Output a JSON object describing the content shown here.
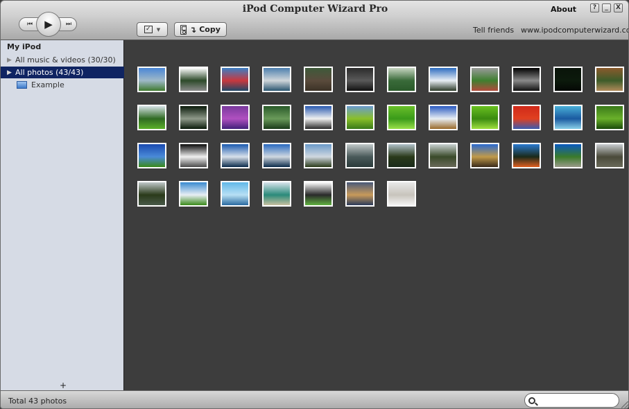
{
  "window": {
    "title": "iPod Computer Wizard Pro",
    "about_label": "About",
    "help_icon": "?",
    "minimize_icon": "_",
    "close_icon": "X"
  },
  "transport": {
    "prev_icon": "⏮",
    "play_icon": "▶",
    "next_icon": "⏭"
  },
  "toolbar": {
    "check_icon": "✓",
    "dropdown_icon": "▼",
    "copy_arrow_icon": "↴",
    "copy_label": "Copy"
  },
  "links": {
    "tell_friends": "Tell friends",
    "website": "www.ipodcomputerwizard.com"
  },
  "sidebar": {
    "title": "My iPod",
    "items": [
      {
        "label": "All music & videos (30/30)",
        "icon": "▶",
        "selected": false
      },
      {
        "label": "All photos (43/43)",
        "icon": "▶",
        "selected": true
      },
      {
        "label": "Example",
        "icon": "album-icon",
        "selected": false
      }
    ],
    "add_icon": "+"
  },
  "photos": {
    "columns": 12,
    "count": 43,
    "items": [
      {
        "name": "city-skyline",
        "colors": [
          "#4a86d6",
          "#9fb9c8",
          "#3f7a2e"
        ]
      },
      {
        "name": "pavilion",
        "colors": [
          "#ffffff",
          "#2d4a2a",
          "#8a8a8a"
        ]
      },
      {
        "name": "cruise-ship",
        "colors": [
          "#3b7fc4",
          "#c9383e",
          "#1f4766"
        ]
      },
      {
        "name": "sea-sky",
        "colors": [
          "#4d7fae",
          "#d0d6da",
          "#2a5670"
        ]
      },
      {
        "name": "garden-path",
        "colors": [
          "#3e5a3a",
          "#5a4b3c",
          "#3b3226"
        ]
      },
      {
        "name": "screens-room",
        "colors": [
          "#2b2b2b",
          "#5a5a5a",
          "#111111"
        ]
      },
      {
        "name": "fountain",
        "colors": [
          "#c8d6c2",
          "#3a6b3a",
          "#2a5a2a"
        ]
      },
      {
        "name": "rock-sky",
        "colors": [
          "#2d6cc0",
          "#e8eef4",
          "#2c3a28"
        ]
      },
      {
        "name": "stadium",
        "colors": [
          "#9a9a9a",
          "#3f7f2f",
          "#b24a3c"
        ]
      },
      {
        "name": "statue-dark",
        "colors": [
          "#000000",
          "#8a8a8a",
          "#111111"
        ]
      },
      {
        "name": "night-lights",
        "colors": [
          "#0a140a",
          "#0c1a0c",
          "#050805"
        ]
      },
      {
        "name": "bamboo",
        "colors": [
          "#8a5a2c",
          "#3d5c2a",
          "#b08a5a"
        ]
      },
      {
        "name": "jungle",
        "colors": [
          "#d6e2e6",
          "#2f6a22",
          "#5bb02a"
        ]
      },
      {
        "name": "disco-ball",
        "colors": [
          "#0a1a0a",
          "#8f9a8a",
          "#0a1a0a"
        ]
      },
      {
        "name": "purple-cells",
        "colors": [
          "#7a3a9c",
          "#b050c0",
          "#40207a"
        ]
      },
      {
        "name": "pond-trees",
        "colors": [
          "#2a5a2a",
          "#6a9a5a",
          "#1a3a1a"
        ]
      },
      {
        "name": "white-house",
        "colors": [
          "#2a5ab0",
          "#f0f0f0",
          "#2a2a2a"
        ]
      },
      {
        "name": "green-leaves",
        "colors": [
          "#6a9ad0",
          "#8ac02a",
          "#3a7a1a"
        ]
      },
      {
        "name": "leaf-veins",
        "colors": [
          "#6ac02a",
          "#3a9a1a",
          "#9ae04a"
        ]
      },
      {
        "name": "wheat-field",
        "colors": [
          "#2a5ac0",
          "#e8eef4",
          "#9a6a2a"
        ]
      },
      {
        "name": "green-leaf",
        "colors": [
          "#6ac020",
          "#3a8a10",
          "#a0e040"
        ]
      },
      {
        "name": "red-leaves",
        "colors": [
          "#d02a1a",
          "#e04020",
          "#3a5ab0"
        ]
      },
      {
        "name": "blue-rays",
        "colors": [
          "#4ab0d8",
          "#1a5aa0",
          "#8ad0e8"
        ]
      },
      {
        "name": "dewdrop-leaf",
        "colors": [
          "#3a7a1a",
          "#6ab02a",
          "#1a4a0a"
        ]
      },
      {
        "name": "blue-sky-field",
        "colors": [
          "#1a4ab0",
          "#4a8ad8",
          "#3a8a1a"
        ]
      },
      {
        "name": "dark-alley",
        "colors": [
          "#0a0a0a",
          "#f0f0f0",
          "#4a4a4a"
        ]
      },
      {
        "name": "lake-clouds",
        "colors": [
          "#1a5ab0",
          "#d8e0ea",
          "#0a2a4a"
        ]
      },
      {
        "name": "calm-lake",
        "colors": [
          "#2a6ac0",
          "#d0d8e0",
          "#0a2a4a"
        ]
      },
      {
        "name": "lake-shore",
        "colors": [
          "#6a9ac8",
          "#d0d8e0",
          "#2a3a1a"
        ]
      },
      {
        "name": "harbor-boats",
        "colors": [
          "#c0c8c8",
          "#4a5a5a",
          "#2a3a3a"
        ]
      },
      {
        "name": "cloudy-coast",
        "colors": [
          "#b0c0c8",
          "#2a3a1a",
          "#1a2a1a"
        ]
      },
      {
        "name": "coastal-hill",
        "colors": [
          "#c8d0d0",
          "#3a4a2a",
          "#6a6a5a"
        ]
      },
      {
        "name": "yellow-house",
        "colors": [
          "#2a6ad0",
          "#c09a4a",
          "#3a2a1a"
        ]
      },
      {
        "name": "autumn-trees",
        "colors": [
          "#2a7ad0",
          "#1a2a1a",
          "#e06020"
        ]
      },
      {
        "name": "road-blue-sky",
        "colors": [
          "#0a5ac0",
          "#3a7a2a",
          "#9a9a8a"
        ]
      },
      {
        "name": "street-lamp",
        "colors": [
          "#c8ccd0",
          "#4a4a3a",
          "#6a6a5a"
        ]
      },
      {
        "name": "river-reflection",
        "colors": [
          "#c0c8c8",
          "#2a3a1a",
          "#4a5a4a"
        ]
      },
      {
        "name": "field-path",
        "colors": [
          "#3a8ad0",
          "#e8eef4",
          "#3a8a1a"
        ]
      },
      {
        "name": "fisheye-sky",
        "colors": [
          "#60b8e8",
          "#b8e0f4",
          "#2a6aa0"
        ]
      },
      {
        "name": "rock-sculpture",
        "colors": [
          "#d8e4ec",
          "#2a8a7a",
          "#c8c0a0"
        ]
      },
      {
        "name": "ipod-family",
        "colors": [
          "#ffffff",
          "#2a2a2a",
          "#60b040"
        ]
      },
      {
        "name": "swimming-dog",
        "colors": [
          "#4a5a7a",
          "#c89a5a",
          "#2a3a5a"
        ]
      },
      {
        "name": "white-kittens",
        "colors": [
          "#e8e8e8",
          "#c8c4bc",
          "#f4f4f4"
        ]
      }
    ]
  },
  "status": {
    "total_text": "Total 43 photos",
    "search_placeholder": ""
  }
}
